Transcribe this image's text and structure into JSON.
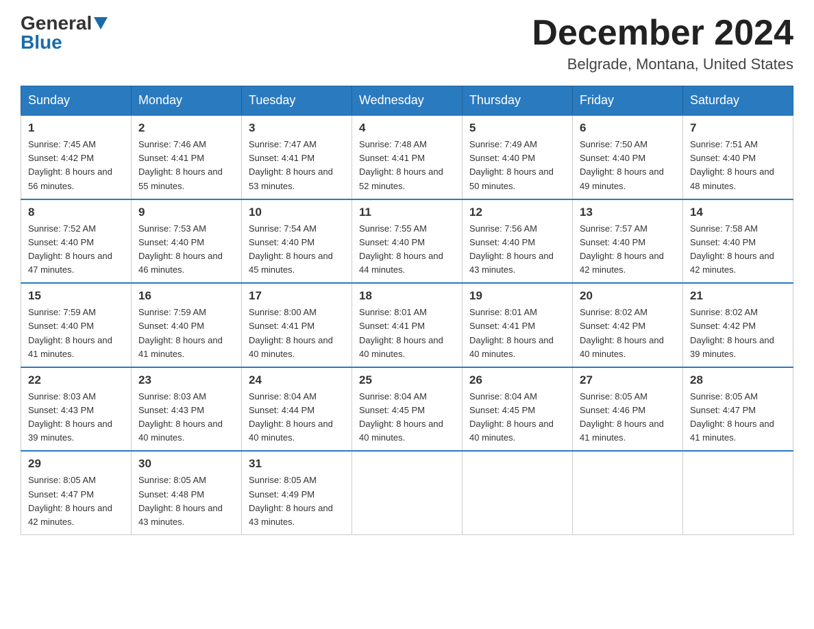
{
  "header": {
    "logo_general": "General",
    "logo_blue": "Blue",
    "title": "December 2024",
    "subtitle": "Belgrade, Montana, United States"
  },
  "days_of_week": [
    "Sunday",
    "Monday",
    "Tuesday",
    "Wednesday",
    "Thursday",
    "Friday",
    "Saturday"
  ],
  "weeks": [
    [
      {
        "date": "1",
        "sunrise": "7:45 AM",
        "sunset": "4:42 PM",
        "daylight": "8 hours and 56 minutes."
      },
      {
        "date": "2",
        "sunrise": "7:46 AM",
        "sunset": "4:41 PM",
        "daylight": "8 hours and 55 minutes."
      },
      {
        "date": "3",
        "sunrise": "7:47 AM",
        "sunset": "4:41 PM",
        "daylight": "8 hours and 53 minutes."
      },
      {
        "date": "4",
        "sunrise": "7:48 AM",
        "sunset": "4:41 PM",
        "daylight": "8 hours and 52 minutes."
      },
      {
        "date": "5",
        "sunrise": "7:49 AM",
        "sunset": "4:40 PM",
        "daylight": "8 hours and 50 minutes."
      },
      {
        "date": "6",
        "sunrise": "7:50 AM",
        "sunset": "4:40 PM",
        "daylight": "8 hours and 49 minutes."
      },
      {
        "date": "7",
        "sunrise": "7:51 AM",
        "sunset": "4:40 PM",
        "daylight": "8 hours and 48 minutes."
      }
    ],
    [
      {
        "date": "8",
        "sunrise": "7:52 AM",
        "sunset": "4:40 PM",
        "daylight": "8 hours and 47 minutes."
      },
      {
        "date": "9",
        "sunrise": "7:53 AM",
        "sunset": "4:40 PM",
        "daylight": "8 hours and 46 minutes."
      },
      {
        "date": "10",
        "sunrise": "7:54 AM",
        "sunset": "4:40 PM",
        "daylight": "8 hours and 45 minutes."
      },
      {
        "date": "11",
        "sunrise": "7:55 AM",
        "sunset": "4:40 PM",
        "daylight": "8 hours and 44 minutes."
      },
      {
        "date": "12",
        "sunrise": "7:56 AM",
        "sunset": "4:40 PM",
        "daylight": "8 hours and 43 minutes."
      },
      {
        "date": "13",
        "sunrise": "7:57 AM",
        "sunset": "4:40 PM",
        "daylight": "8 hours and 42 minutes."
      },
      {
        "date": "14",
        "sunrise": "7:58 AM",
        "sunset": "4:40 PM",
        "daylight": "8 hours and 42 minutes."
      }
    ],
    [
      {
        "date": "15",
        "sunrise": "7:59 AM",
        "sunset": "4:40 PM",
        "daylight": "8 hours and 41 minutes."
      },
      {
        "date": "16",
        "sunrise": "7:59 AM",
        "sunset": "4:40 PM",
        "daylight": "8 hours and 41 minutes."
      },
      {
        "date": "17",
        "sunrise": "8:00 AM",
        "sunset": "4:41 PM",
        "daylight": "8 hours and 40 minutes."
      },
      {
        "date": "18",
        "sunrise": "8:01 AM",
        "sunset": "4:41 PM",
        "daylight": "8 hours and 40 minutes."
      },
      {
        "date": "19",
        "sunrise": "8:01 AM",
        "sunset": "4:41 PM",
        "daylight": "8 hours and 40 minutes."
      },
      {
        "date": "20",
        "sunrise": "8:02 AM",
        "sunset": "4:42 PM",
        "daylight": "8 hours and 40 minutes."
      },
      {
        "date": "21",
        "sunrise": "8:02 AM",
        "sunset": "4:42 PM",
        "daylight": "8 hours and 39 minutes."
      }
    ],
    [
      {
        "date": "22",
        "sunrise": "8:03 AM",
        "sunset": "4:43 PM",
        "daylight": "8 hours and 39 minutes."
      },
      {
        "date": "23",
        "sunrise": "8:03 AM",
        "sunset": "4:43 PM",
        "daylight": "8 hours and 40 minutes."
      },
      {
        "date": "24",
        "sunrise": "8:04 AM",
        "sunset": "4:44 PM",
        "daylight": "8 hours and 40 minutes."
      },
      {
        "date": "25",
        "sunrise": "8:04 AM",
        "sunset": "4:45 PM",
        "daylight": "8 hours and 40 minutes."
      },
      {
        "date": "26",
        "sunrise": "8:04 AM",
        "sunset": "4:45 PM",
        "daylight": "8 hours and 40 minutes."
      },
      {
        "date": "27",
        "sunrise": "8:05 AM",
        "sunset": "4:46 PM",
        "daylight": "8 hours and 41 minutes."
      },
      {
        "date": "28",
        "sunrise": "8:05 AM",
        "sunset": "4:47 PM",
        "daylight": "8 hours and 41 minutes."
      }
    ],
    [
      {
        "date": "29",
        "sunrise": "8:05 AM",
        "sunset": "4:47 PM",
        "daylight": "8 hours and 42 minutes."
      },
      {
        "date": "30",
        "sunrise": "8:05 AM",
        "sunset": "4:48 PM",
        "daylight": "8 hours and 43 minutes."
      },
      {
        "date": "31",
        "sunrise": "8:05 AM",
        "sunset": "4:49 PM",
        "daylight": "8 hours and 43 minutes."
      },
      null,
      null,
      null,
      null
    ]
  ]
}
